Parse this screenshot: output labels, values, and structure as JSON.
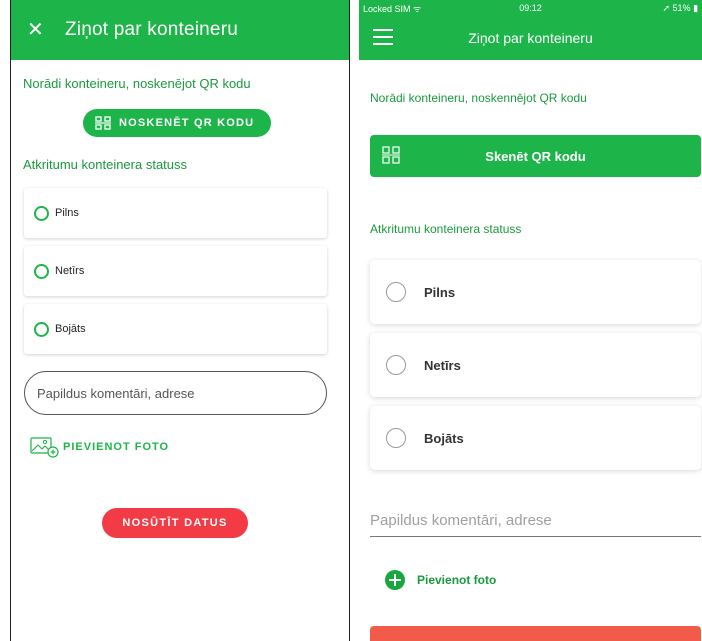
{
  "android": {
    "title": "Ziņot par konteineru",
    "close_icon": "close-icon",
    "scan_hint": "Norādi konteineru, noskenējot QR kodu",
    "scan_button": "NOSKENĒT QR KODU",
    "status_heading": "Atkritumu konteinera statuss",
    "options": [
      "Pilns",
      "Netīrs",
      "Bojāts"
    ],
    "comment_placeholder": "Papildus komentāri, adrese",
    "add_photo": "PIEVIENOT FOTO",
    "submit": "NOSŪTĪT DATUS",
    "colors": {
      "primary": "#1db54a",
      "accent": "#f23b45"
    }
  },
  "ios": {
    "statusbar": {
      "carrier": "Locked SIM",
      "time": "09:12",
      "battery": "51%"
    },
    "title": "Ziņot par konteineru",
    "menu_icon": "hamburger-menu-icon",
    "scan_hint": "Norādi konteineru, noskennējot QR kodu",
    "scan_button": "Skenēt QR kodu",
    "status_heading": "Atkritumu konteinera statuss",
    "options": [
      "Pilns",
      "Netīrs",
      "Bojāts"
    ],
    "comment_placeholder": "Papildus komentāri, adrese",
    "add_photo": "Pievienot foto",
    "colors": {
      "primary": "#1db54a",
      "accent": "#f25a4a"
    }
  }
}
